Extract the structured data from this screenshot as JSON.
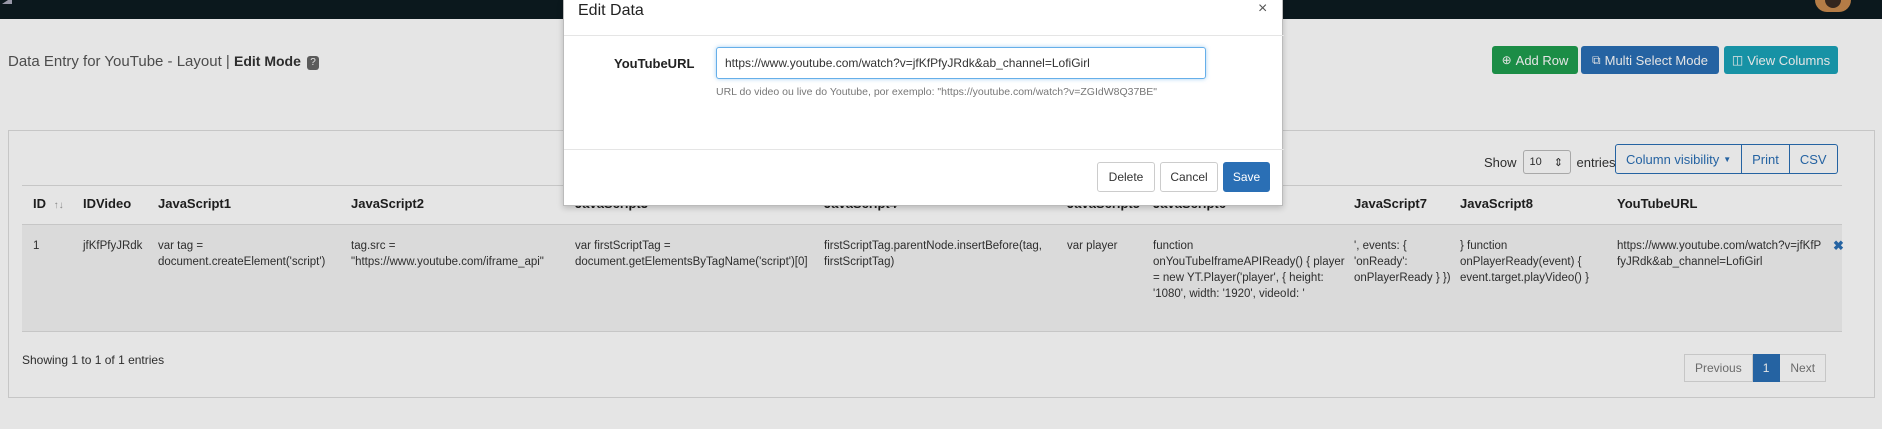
{
  "header": {
    "title": "Data Entry for YouTube - Layout |",
    "mode": "Edit Mode",
    "help_glyph": "?"
  },
  "toolbar": {
    "add_row": "Add Row",
    "multi_select": "Multi Select Mode",
    "view_columns": "View Columns"
  },
  "table_controls": {
    "show_label": "Show",
    "page_size": "10",
    "entries_label": "entries",
    "column_visibility": "Column visibility",
    "print": "Print",
    "csv": "CSV"
  },
  "table": {
    "columns": [
      "ID",
      "IDVideo",
      "JavaScript1",
      "JavaScript2",
      "JavaScript3",
      "JavaScript4",
      "JavaScript5",
      "JavaScript6",
      "JavaScript7",
      "JavaScript8",
      "YouTubeURL"
    ],
    "sort_glyph": "↑↓",
    "rows": [
      [
        "1",
        "jfKfPfyJRdk",
        "var tag = document.createElement('script')",
        "tag.src = \"https://www.youtube.com/iframe_api\"",
        "var firstScriptTag = document.getElementsByTagName('script')[0]",
        "firstScriptTag.parentNode.insertBefore(tag, firstScriptTag)",
        "var player",
        "function onYouTubeIframeAPIReady() { player = new YT.Player('player', { height: '1080', width: '1920', videoId: '",
        "', events: { 'onReady': onPlayerReady } })",
        "} function onPlayerReady(event) { event.target.playVideo() }",
        "https://www.youtube.com/watch?v=jfKfPfyJRdk&ab_channel=LofiGirl"
      ]
    ],
    "delete_glyph": "✖"
  },
  "footer": {
    "info": "Showing 1 to 1 of 1 entries",
    "previous": "Previous",
    "page": "1",
    "next": "Next"
  },
  "modal": {
    "title": "Edit Data",
    "close_glyph": "×",
    "field_label": "YouTubeURL",
    "field_value": "https://www.youtube.com/watch?v=jfKfPfyJRdk&ab_channel=LofiGirl",
    "help_text": "URL do video ou live do Youtube, por exemplo: \"https://youtube.com/watch?v=ZGIdW8Q37BE\"",
    "delete": "Delete",
    "cancel": "Cancel",
    "save": "Save"
  },
  "colors": {
    "primary": "#2a6fb5",
    "success": "#1f9d4e",
    "info": "#1aa3b8",
    "navbar": "#0d1b21"
  }
}
